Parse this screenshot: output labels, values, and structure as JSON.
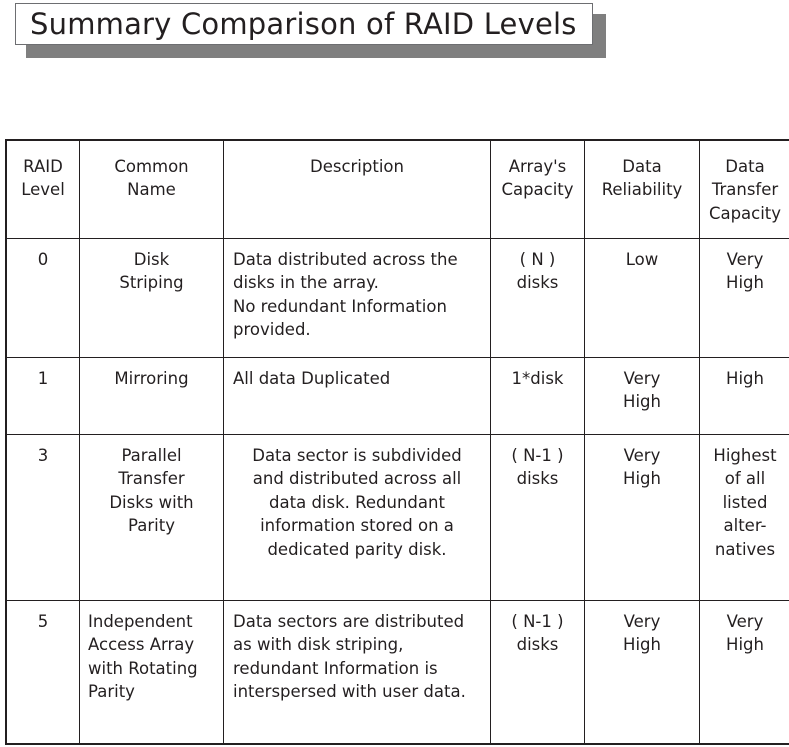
{
  "title": {
    "text": "Summary Comparison of RAID Levels"
  },
  "table": {
    "headers": {
      "level": "RAID\nLevel",
      "name": "Common\nName",
      "description": "Description",
      "capacity": "Array's\nCapacity",
      "reliability": "Data\nReliability",
      "transfer": "Data\nTransfer\nCapacity"
    },
    "rows": [
      {
        "level": "0",
        "name": "Disk\nStriping",
        "description": "Data distributed across the\ndisks in the array.\nNo redundant Information\nprovided.",
        "capacity": "( N )\ndisks",
        "reliability": "Low",
        "transfer": "Very\nHigh"
      },
      {
        "level": "1",
        "name": "Mirroring",
        "description": "All data Duplicated",
        "capacity": "1*disk",
        "reliability": "Very\nHigh",
        "transfer": "High"
      },
      {
        "level": "3",
        "name": "Parallel\nTransfer\nDisks with\nParity",
        "description": "Data sector is subdivided\nand distributed across all\ndata disk. Redundant\ninformation stored on a\ndedicated parity disk.",
        "capacity": "( N-1 )\ndisks",
        "reliability": "Very\nHigh",
        "transfer": "Highest\nof all\nlisted\nalter-\nnatives"
      },
      {
        "level": "5",
        "name": "Independent\nAccess Array\nwith Rotating\nParity",
        "description": "Data sectors are distributed\nas with disk striping,\nredundant Information is\ninterspersed with user data.",
        "capacity": "( N-1 )\ndisks",
        "reliability": "Very\nHigh",
        "transfer": "Very\nHigh"
      }
    ]
  },
  "colors": {
    "text": "#231f20",
    "border": "#231f20",
    "shadow": "#7f7f7f",
    "background": "#ffffff"
  }
}
